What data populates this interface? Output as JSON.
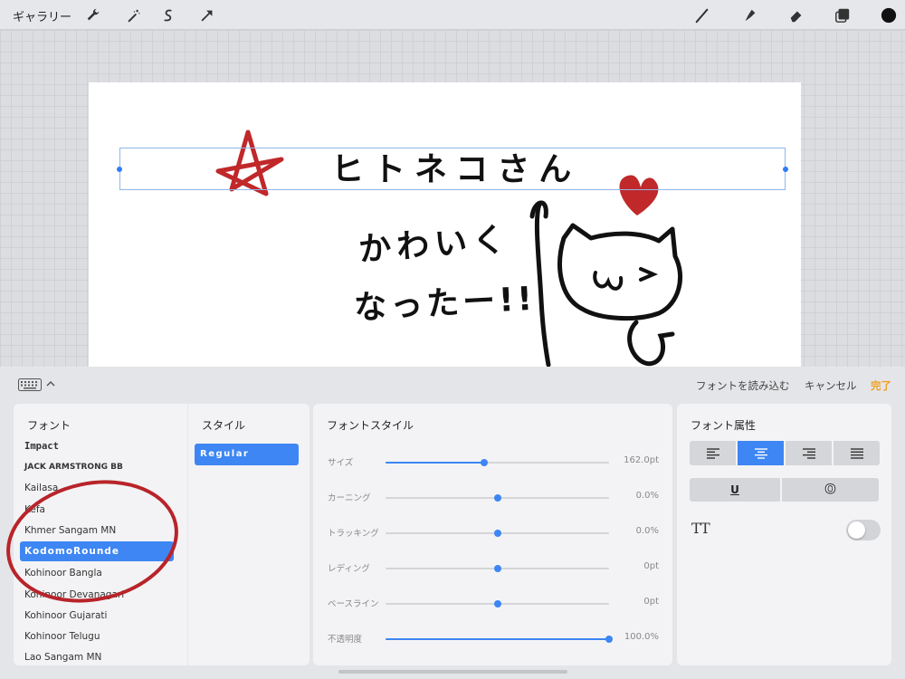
{
  "toolbar": {
    "gallery": "ギャラリー",
    "left_tools": [
      "wrench-icon",
      "magic-wand-icon",
      "selection-s-icon",
      "transform-arrow-icon"
    ],
    "right_tools": [
      "brush-icon",
      "smudge-icon",
      "eraser-icon",
      "layers-icon"
    ],
    "current_color": "#111111"
  },
  "canvas": {
    "text_layer": "ヒトネコさん",
    "handwriting_line1": "かわいく",
    "handwriting_line2": "なったー!!",
    "ink_color": "#111111",
    "doodle_color": "#c0282a"
  },
  "panel_bar": {
    "import_fonts": "フォントを読み込む",
    "cancel": "キャンセル",
    "done": "完了"
  },
  "fonts": {
    "title": "フォント",
    "items": [
      "Impact",
      "JACK ARMSTRONG BB",
      "Kailasa",
      "Kefa",
      "Khmer Sangam MN",
      "KodomoRounde",
      "Kohinoor Bangla",
      "Kohinoor Devanagari",
      "Kohinoor Gujarati",
      "Kohinoor Telugu",
      "Lao Sangam MN"
    ],
    "selected_index": 5
  },
  "styles": {
    "title": "スタイル",
    "items": [
      "Regular"
    ]
  },
  "font_style": {
    "title": "フォントスタイル",
    "sliders": [
      {
        "label": "サイズ",
        "value": "162.0pt",
        "level": 0.44
      },
      {
        "label": "カーニング",
        "value": "0.0%",
        "level": 0.5
      },
      {
        "label": "トラッキング",
        "value": "0.0%",
        "level": 0.5
      },
      {
        "label": "レディング",
        "value": "0pt",
        "level": 0.5
      },
      {
        "label": "ベースライン",
        "value": "0pt",
        "level": 0.5
      },
      {
        "label": "不透明度",
        "value": "100.0%",
        "level": 1.0
      }
    ]
  },
  "font_attrs": {
    "title": "フォント属性",
    "alignments": [
      "align-left-icon",
      "align-center-icon",
      "align-right-icon",
      "align-justify-icon"
    ],
    "selected_alignment": 1,
    "underline": "U",
    "outline": "O",
    "all_caps": "TT",
    "all_caps_on": false
  },
  "colors": {
    "accent": "#3d86f3",
    "done": "#f1a020"
  }
}
